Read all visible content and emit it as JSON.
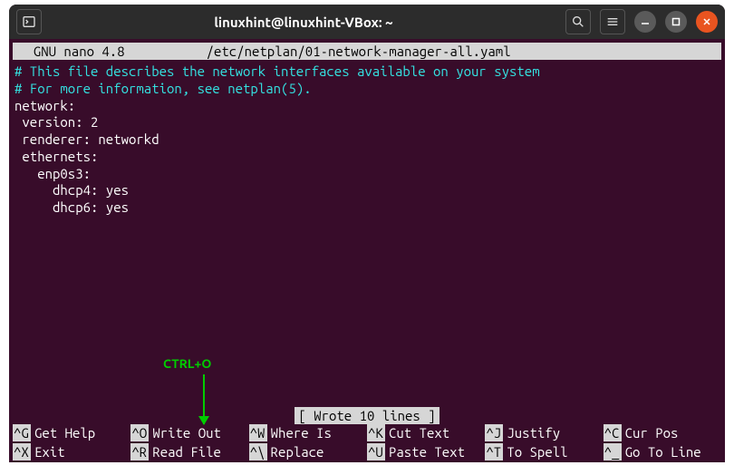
{
  "window": {
    "title": "linuxhint@linuxhint-VBox: ~"
  },
  "nano": {
    "app": "  GNU nano 4.8",
    "filepath": "/etc/netplan/01-network-manager-all.yaml",
    "status": "[ Wrote 10 lines ]"
  },
  "content": {
    "lines": [
      {
        "text": "# This file describes the network interfaces available on your system",
        "cls": "comment"
      },
      {
        "text": "# For more information, see netplan(5).",
        "cls": "comment"
      },
      {
        "text": "network:",
        "cls": "plain"
      },
      {
        "text": " version: 2",
        "cls": "plain"
      },
      {
        "text": " renderer: networkd",
        "cls": "plain"
      },
      {
        "text": " ethernets:",
        "cls": "plain"
      },
      {
        "text": "   enp0s3:",
        "cls": "plain"
      },
      {
        "text": "     dhcp4: yes",
        "cls": "plain"
      },
      {
        "text": "     dhcp6: yes",
        "cls": "plain"
      }
    ]
  },
  "annotation": {
    "label": "CTRL+O"
  },
  "shortcuts": {
    "row1": [
      {
        "key": "^G",
        "label": "Get Help"
      },
      {
        "key": "^O",
        "label": "Write Out"
      },
      {
        "key": "^W",
        "label": "Where Is"
      },
      {
        "key": "^K",
        "label": "Cut Text"
      },
      {
        "key": "^J",
        "label": "Justify"
      },
      {
        "key": "^C",
        "label": "Cur Pos"
      }
    ],
    "row2": [
      {
        "key": "^X",
        "label": "Exit"
      },
      {
        "key": "^R",
        "label": "Read File"
      },
      {
        "key": "^\\",
        "label": "Replace"
      },
      {
        "key": "^U",
        "label": "Paste Text"
      },
      {
        "key": "^T",
        "label": "To Spell"
      },
      {
        "key": "^_",
        "label": "Go To Line"
      }
    ]
  }
}
